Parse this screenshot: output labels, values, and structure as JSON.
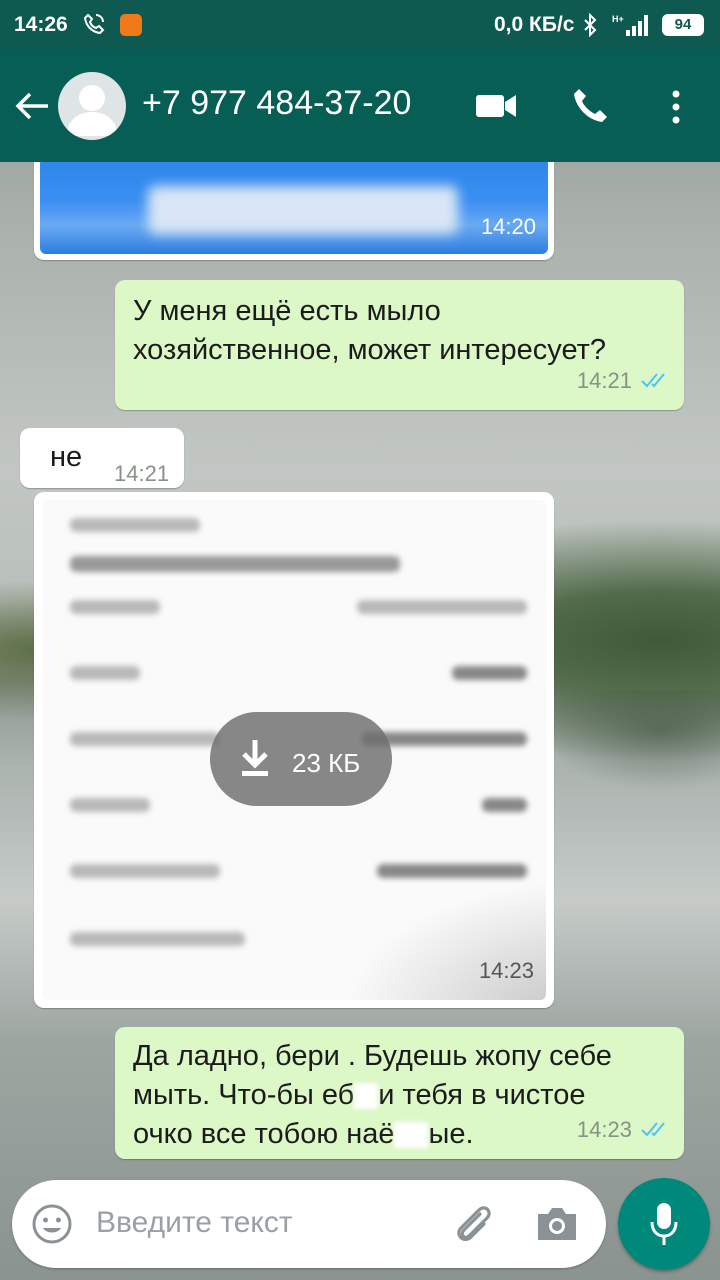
{
  "status_bar": {
    "time": "14:26",
    "speed": "0,0 КБ/с",
    "battery": "94"
  },
  "header": {
    "contact": "+7 977 484-37-20"
  },
  "chat": {
    "image_message": {
      "time": "14:20"
    },
    "msg_out_1": {
      "lines": [
        "У меня ещё есть мыло",
        "хозяйственное, может интересует?"
      ],
      "time": "14:21"
    },
    "msg_in_1": {
      "text": "не",
      "time": "14:21"
    },
    "document_message": {
      "download_size": "23 КБ",
      "time": "14:23"
    },
    "msg_out_2": {
      "lines": [
        "Да ладно, бери . Будешь жопу себе",
        "мыть.  Что-бы еб",
        "и тебя в чистое",
        "очко все тобою наё",
        "ые."
      ],
      "time": "14:23"
    }
  },
  "composer": {
    "placeholder": "Введите текст"
  },
  "colors": {
    "header": "#075e54",
    "status_bar": "#0f5a50",
    "outgoing": "#dcf8c6",
    "ticks": "#4fc3f7",
    "accent": "#00897b"
  }
}
